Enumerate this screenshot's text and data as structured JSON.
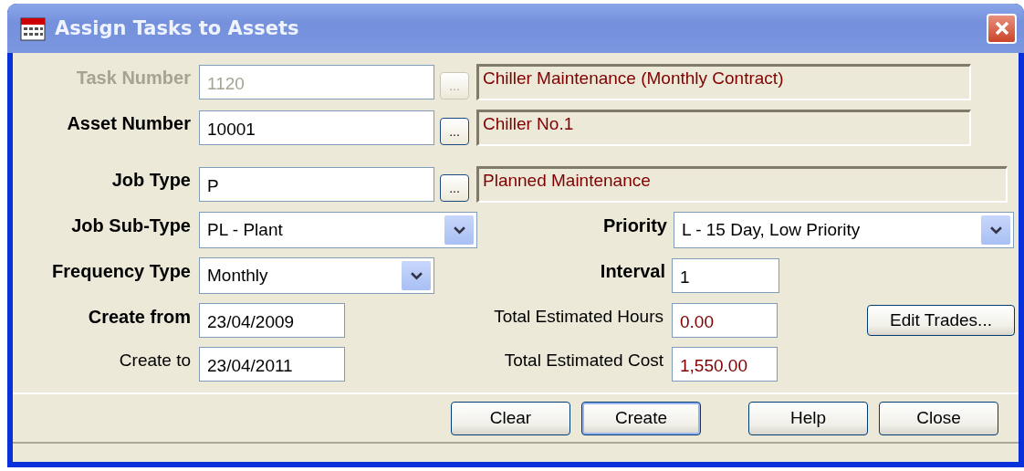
{
  "window": {
    "title": "Assign Tasks to Assets"
  },
  "lookups": [
    {
      "label": "Task Number",
      "required": true,
      "disabled": true,
      "value": "1120",
      "browse": "...",
      "description": "Chiller Maintenance (Monthly Contract)"
    },
    {
      "label": "Asset Number",
      "required": true,
      "disabled": false,
      "value": "10001",
      "browse": "...",
      "description": "Chiller No.1"
    },
    {
      "label": "Job Type",
      "required": true,
      "disabled": false,
      "value": "P",
      "browse": "...",
      "description": "Planned Maintenance"
    }
  ],
  "job_sub_type": {
    "label": "Job Sub-Type",
    "required": true,
    "value": "PL - Plant"
  },
  "priority": {
    "label": "Priority",
    "required": true,
    "value": "L - 15 Day, Low Priority"
  },
  "frequency_type": {
    "label": "Frequency Type",
    "required": true,
    "value": "Monthly"
  },
  "interval": {
    "label": "Interval",
    "required": true,
    "value": "1"
  },
  "create_from": {
    "label": "Create from",
    "required": true,
    "value": "23/04/2009"
  },
  "create_to": {
    "label": "Create to",
    "required": false,
    "value": "23/04/2011"
  },
  "total_estimated_hours": {
    "label": "Total Estimated Hours",
    "required": false,
    "value": "0.00"
  },
  "total_estimated_cost": {
    "label": "Total Estimated Cost",
    "required": false,
    "value": "1,550.00"
  },
  "edit_trades_button": {
    "label": "Edit Trades..."
  },
  "buttons": [
    {
      "label": "Clear",
      "default": false
    },
    {
      "label": "Create",
      "default": true
    },
    {
      "label": "Help",
      "default": false
    },
    {
      "label": "Close",
      "default": false
    }
  ]
}
